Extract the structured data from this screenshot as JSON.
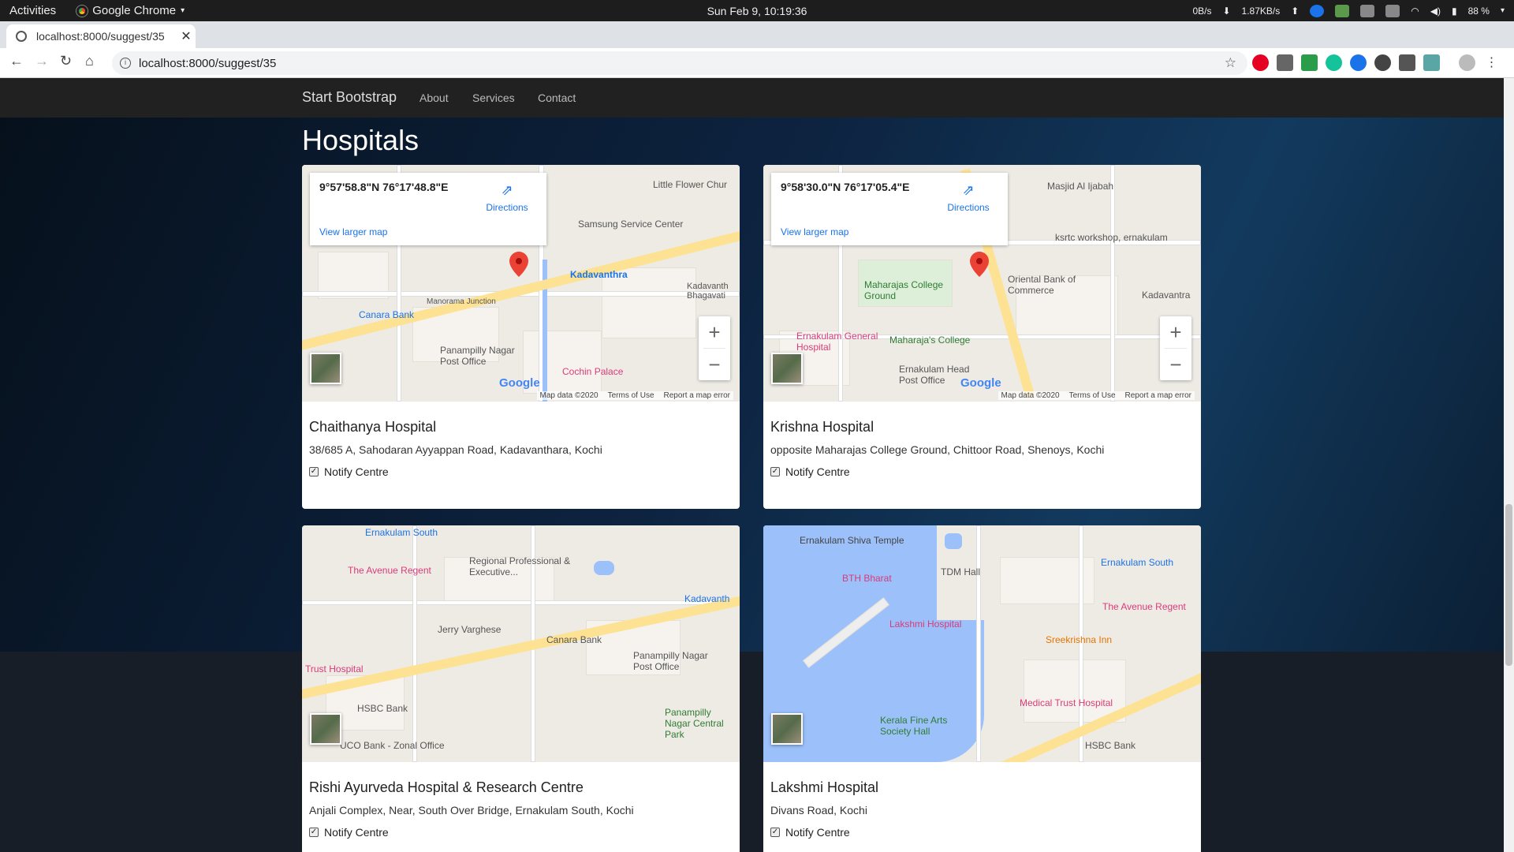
{
  "system_bar": {
    "activities": "Activities",
    "app_name": "Google Chrome",
    "datetime": "Sun Feb  9, 10:19:36",
    "net_down": "0B/s",
    "net_up": "1.87KB/s",
    "battery": "88 %"
  },
  "browser": {
    "tab_title": "localhost:8000/suggest/35",
    "url": "localhost:8000/suggest/35"
  },
  "nav": {
    "brand": "Start Bootstrap",
    "links": [
      "About",
      "Services",
      "Contact"
    ]
  },
  "page": {
    "title": "Hospitals"
  },
  "map_common": {
    "directions": "Directions",
    "view_larger": "View larger map",
    "map_data": "Map data ©2020",
    "terms": "Terms of Use",
    "report": "Report a map error",
    "google": "Google",
    "zoom_in": "+",
    "zoom_out": "−"
  },
  "hospitals": [
    {
      "name": "Chaithanya Hospital",
      "address": "38/685 A, Sahodaran Ayyappan Road, Kadavanthara, Kochi",
      "coords": "9°57'58.8\"N 76°17'48.8\"E",
      "notify": "Notify Centre",
      "places": [
        "Kadavanthra",
        "Canara Bank",
        "Panampilly Nagar Post Office",
        "Manorama Junction",
        "Samsung Service Center",
        "Little Flower Chur",
        "Cochin Palace",
        "Kadavanth Bhagavati"
      ]
    },
    {
      "name": "Krishna Hospital",
      "address": "opposite Maharajas College Ground, Chittoor Road, Shenoys, Kochi",
      "coords": "9°58'30.0\"N 76°17'05.4\"E",
      "notify": "Notify Centre",
      "places": [
        "Maharajas College Ground",
        "Maharaja's College",
        "Ernakulam General Hospital",
        "Ernakulam Head Post Office",
        "Oriental Bank of Commerce",
        "Masjid Al Ijabah",
        "ksrtc workshop, ernakulam",
        "Kadavantra"
      ]
    },
    {
      "name": "Rishi Ayurveda Hospital & Research Centre",
      "address": "Anjali Complex, Near, South Over Bridge, Ernakulam South, Kochi",
      "notify": "Notify Centre",
      "places": [
        "Ernakulam South",
        "The Avenue Regent",
        "Regional Professional & Executive...",
        "Jerry Varghese",
        "Canara Bank",
        "Panampilly Nagar Post Office",
        "HSBC Bank",
        "UCO Bank - Zonal Office",
        "Trust Hospital",
        "Panampilly Nagar Central Park",
        "Kadavanth"
      ]
    },
    {
      "name": "Lakshmi Hospital",
      "address": "Divans Road, Kochi",
      "notify": "Notify Centre",
      "places": [
        "Ernakulam Shiva Temple",
        "TDM Hall",
        "BTH Bharat",
        "Ernakulam South",
        "The Avenue Regent",
        "Lakshmi Hospital",
        "Sreekrishna Inn",
        "Medical Trust Hospital",
        "Kerala Fine Arts Society Hall",
        "HSBC Bank"
      ]
    }
  ],
  "colors": {
    "navbar": "#212121",
    "link": "#1a73e8",
    "pin": "#ea4335",
    "highway": "#fde293",
    "water": "#9cc0f9"
  }
}
